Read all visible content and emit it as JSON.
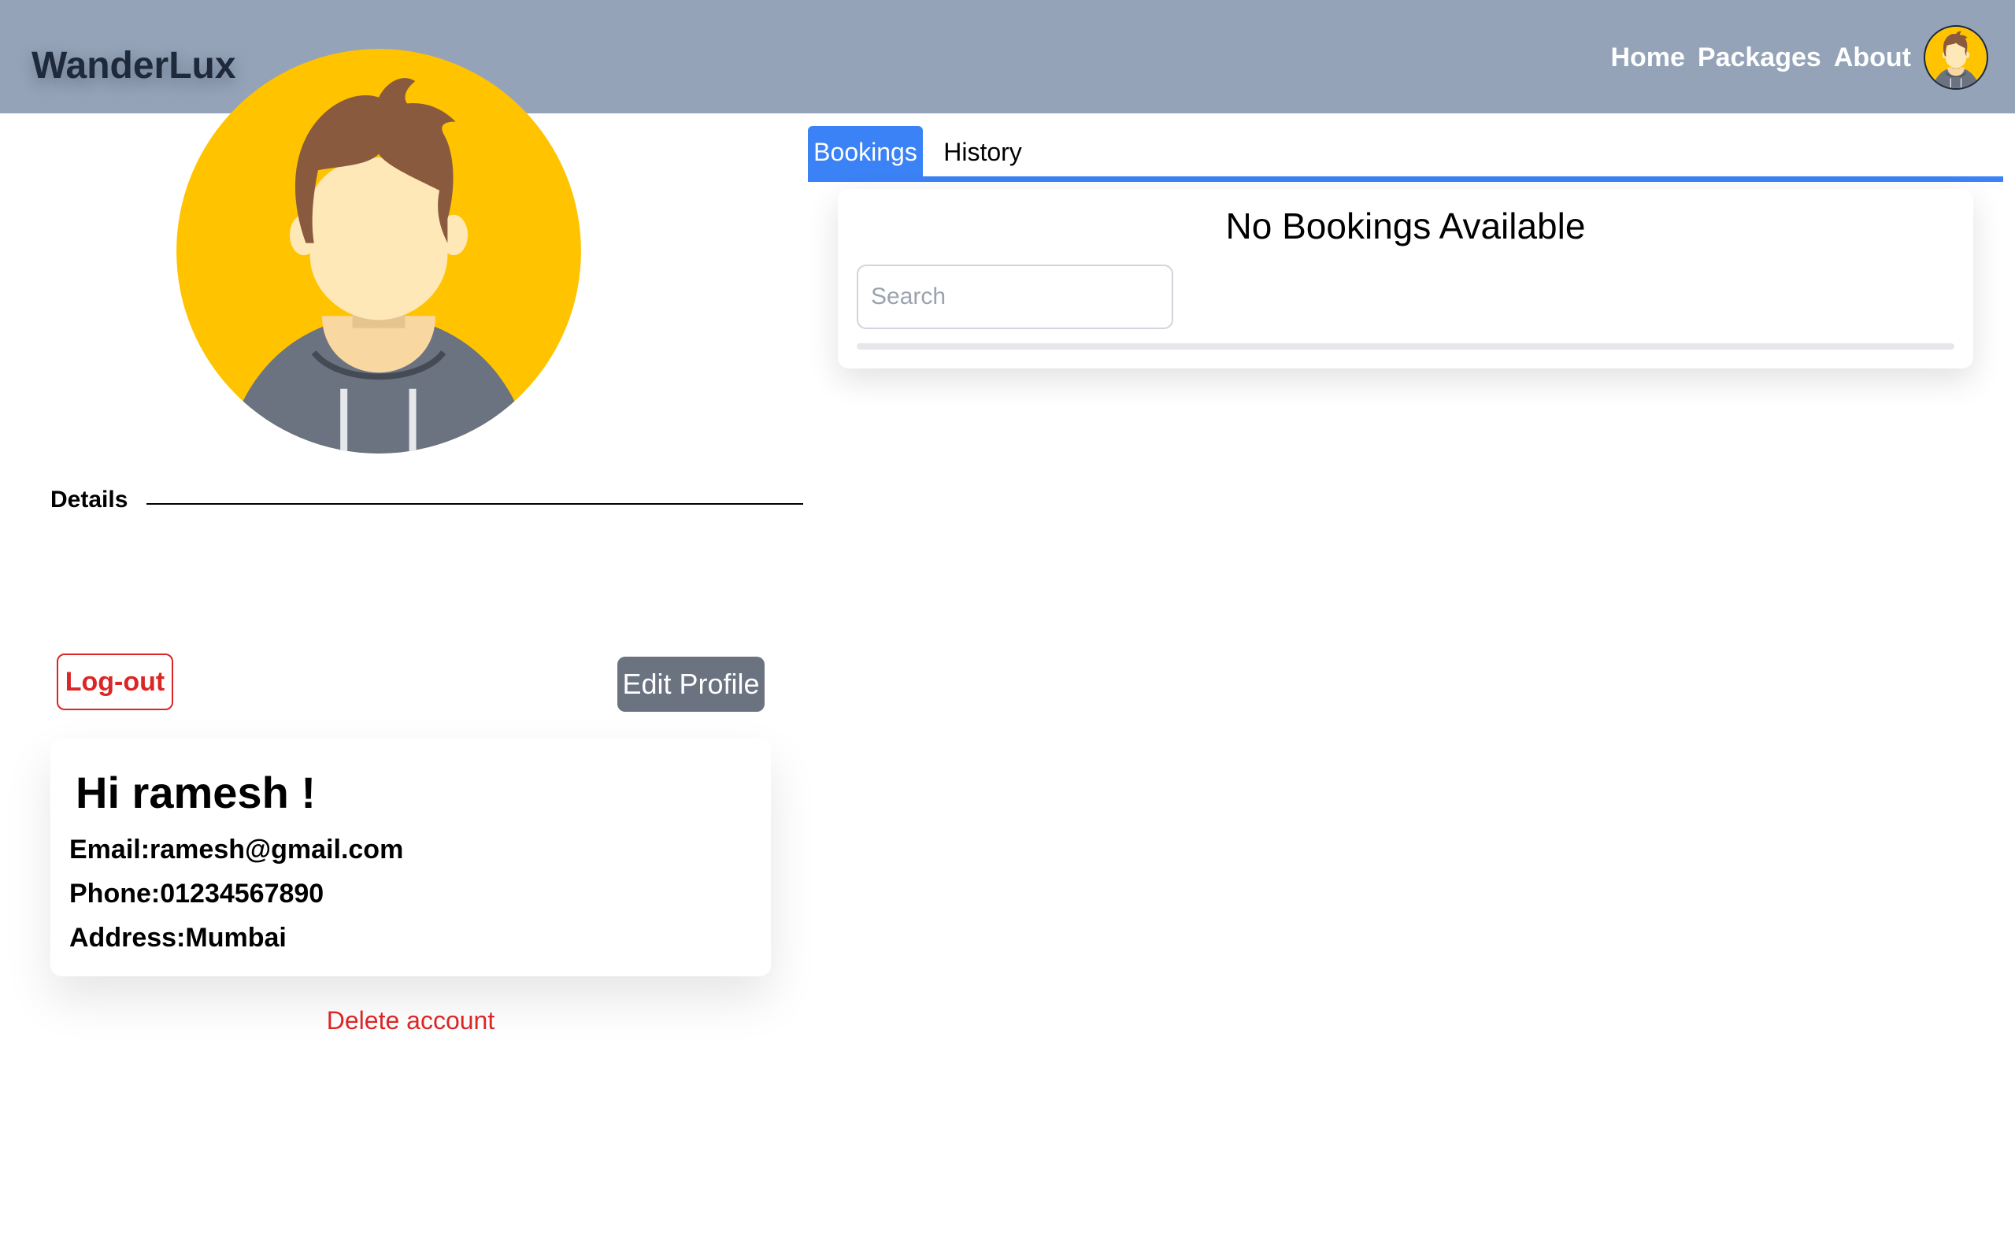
{
  "app": {
    "brand": "WanderLux"
  },
  "nav": {
    "items": [
      "Home",
      "Packages",
      "About"
    ]
  },
  "profile": {
    "details_label": "Details",
    "logout_label": "Log-out",
    "edit_label": "Edit Profile",
    "greeting": "Hi ramesh !",
    "email": "Email:ramesh@gmail.com",
    "phone": "Phone:01234567890",
    "address": "Address:Mumbai",
    "delete_label": "Delete account"
  },
  "tabs": [
    {
      "label": "Bookings",
      "active": true
    },
    {
      "label": "History",
      "active": false
    }
  ],
  "bookings": {
    "empty_message": "No Bookings Available",
    "search_placeholder": "Search"
  },
  "colors": {
    "topbar": "#94a3b8",
    "accent": "#3b82f6",
    "danger": "#dc2626",
    "edit_button": "#6b7280",
    "avatar_bg": "#fbbf24"
  },
  "icons": {
    "avatar": "user-avatar-icon"
  }
}
